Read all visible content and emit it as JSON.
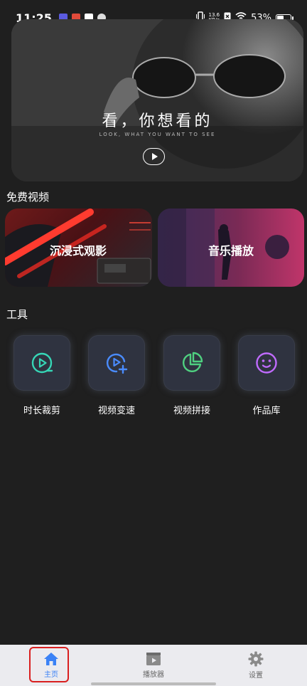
{
  "status_bar": {
    "time": "11:25",
    "net_speed_value": "13.6",
    "net_speed_unit": "KB/s",
    "battery": "53%",
    "battery_level": 0.53
  },
  "hero": {
    "title": "看，你想看的",
    "subtitle": "LOOK, WHAT YOU WANT TO SEE"
  },
  "free_videos": {
    "title": "免费视频",
    "cards": [
      {
        "label": "沉浸式观影"
      },
      {
        "label": "音乐播放"
      }
    ]
  },
  "tools": {
    "title": "工具",
    "items": [
      {
        "label": "时长裁剪",
        "icon": "play-circle-icon",
        "color": "#36d6b6"
      },
      {
        "label": "视频变速",
        "icon": "play-plus-icon",
        "color": "#4a8cff"
      },
      {
        "label": "视频拼接",
        "icon": "pie-chart-icon",
        "color": "#4fd080"
      },
      {
        "label": "作品库",
        "icon": "smile-icon",
        "color": "#c06bff"
      }
    ]
  },
  "bottom_nav": {
    "items": [
      {
        "label": "主页",
        "icon": "home-icon"
      },
      {
        "label": "播放器",
        "icon": "clapper-icon"
      },
      {
        "label": "设置",
        "icon": "gear-icon"
      }
    ],
    "active_color": "#3b82f6"
  }
}
